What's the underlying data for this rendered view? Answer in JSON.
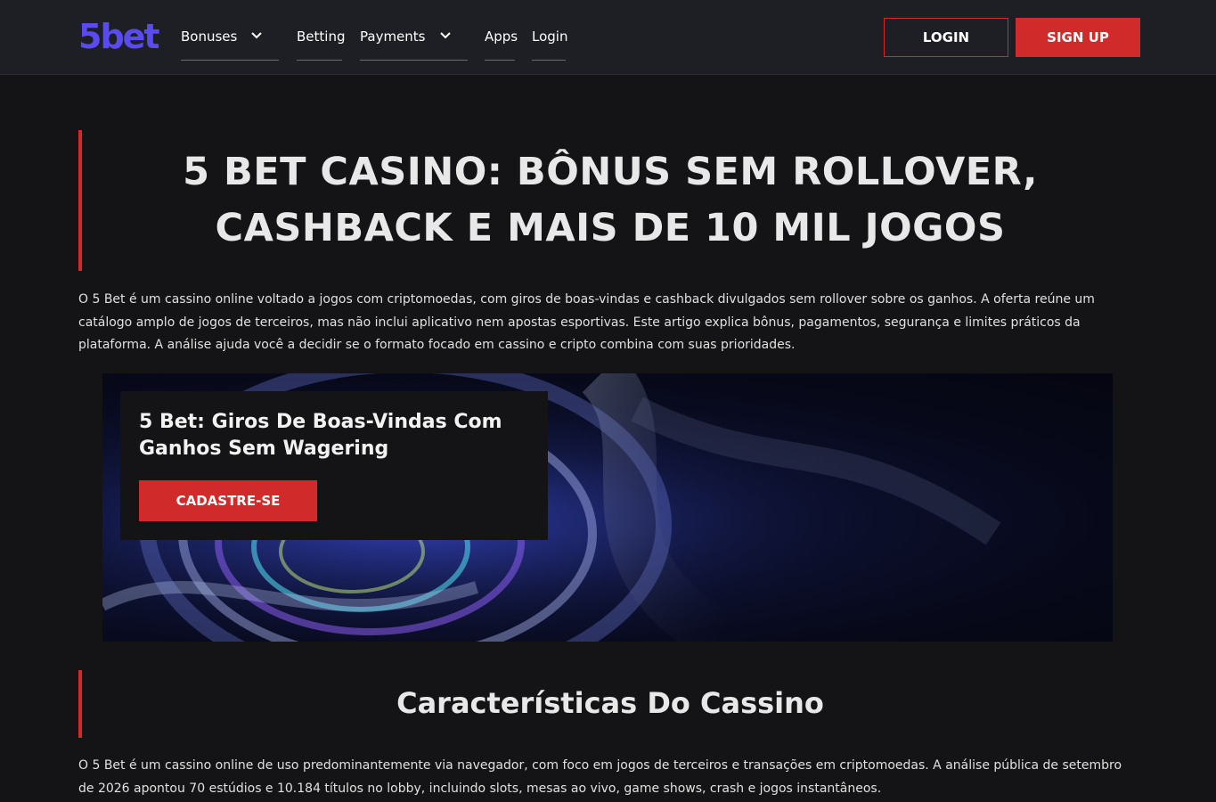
{
  "header": {
    "logo": "5bet",
    "nav": [
      {
        "label": "Bonuses",
        "has_dropdown": true
      },
      {
        "label": "Betting",
        "has_dropdown": false
      },
      {
        "label": "Payments",
        "has_dropdown": true
      },
      {
        "label": "Apps",
        "has_dropdown": false
      },
      {
        "label": "Login",
        "has_dropdown": false
      }
    ],
    "login_button": "LOGIN",
    "signup_button": "SIGN UP"
  },
  "main": {
    "title": "5 BET CASINO: BÔNUS SEM ROLLOVER, CASHBACK E MAIS DE 10 MIL JOGOS",
    "intro": "O 5 Bet é um cassino online voltado a jogos com criptomoedas, com giros de boas-vindas e cashback divulgados sem rollover sobre os ganhos. A oferta reúne um catálogo amplo de jogos de terceiros, mas não inclui aplicativo nem apostas esportivas. Este artigo explica bônus, pagamentos, segurança e limites práticos da plataforma. A análise ajuda você a decidir se o formato focado em cassino e cripto combina com suas prioridades.",
    "promo": {
      "title": "5 Bet: Giros De Boas-Vindas Com Ganhos Sem Wagering",
      "button": "CADASTRE-SE"
    },
    "section": {
      "title": "Características Do Cassino",
      "text": "O 5 Bet é um cassino online de uso predominantemente via navegador, com foco em jogos de terceiros e transações em criptomoedas. A análise pública de setembro de 2026 apontou 70 estúdios e 10.184 títulos no lobby, incluindo slots, mesas ao vivo, game shows, crash e jogos instantâneos."
    }
  },
  "colors": {
    "accent_red": "#d02a2a",
    "logo_purple": "#5a4bf0",
    "background": "#141416",
    "header_bg": "#1e1f24"
  }
}
